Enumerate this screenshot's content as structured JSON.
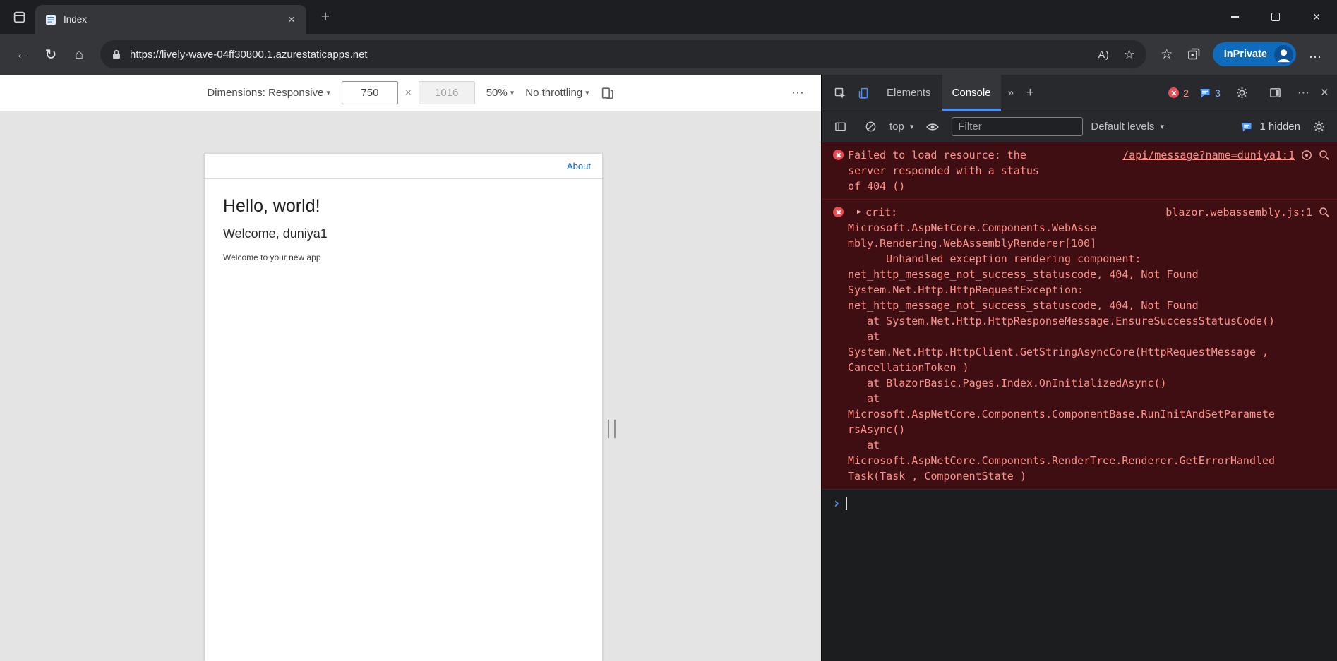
{
  "colors": {
    "accent_blue": "#4e8ef7",
    "inprivate_blue": "#0f6cbd",
    "error_bg": "#3e0e13",
    "error_text": "#ff918a",
    "page_link_blue": "#0366d6"
  },
  "icons": {
    "back": "←",
    "refresh": "↻",
    "home": "⌂",
    "read_aloud": "A)",
    "favorite_star": "☆",
    "favorites_bar": "☆",
    "more_menu": "…",
    "close": "×",
    "tab_close": "×",
    "new_tab": "+",
    "more_tabs": "»",
    "add_panel": "+",
    "dropdown_arrow": "▾",
    "dimension_times": "×",
    "overflow": "⋯",
    "expand_triangle": "▶",
    "prompt_chevron": "›"
  },
  "browser": {
    "tab_title": "Index",
    "url": "https://lively-wave-04ff30800.1.azurestaticapps.net",
    "inprivate_label": "InPrivate"
  },
  "emulation": {
    "dimensions_label": "Dimensions: Responsive",
    "width_value": "750",
    "height_value": "1016",
    "zoom_value": "50%",
    "throttling_value": "No throttling"
  },
  "page": {
    "nav_link_about": "About",
    "heading": "Hello, world!",
    "welcome_text": "Welcome, duniya1",
    "subtitle": "Welcome to your new app"
  },
  "devtools": {
    "tab_elements": "Elements",
    "tab_console": "Console",
    "error_count": "2",
    "issue_count": "3",
    "console_toolbar": {
      "context_selector": "top",
      "filter_placeholder": "Filter",
      "levels_selector": "Default levels",
      "hidden_count": "1 hidden"
    },
    "messages": [
      {
        "text": "Failed to load resource: the\nserver responded with a status\nof 404 ()",
        "source": "/api/message?name=duniya1:1"
      },
      {
        "label": "crit:",
        "source": "blazor.webassembly.js:1",
        "stack": "Microsoft.AspNetCore.Components.WebAsse\nmbly.Rendering.WebAssemblyRenderer[100]\n      Unhandled exception rendering component:\nnet_http_message_not_success_statuscode, 404, Not Found\nSystem.Net.Http.HttpRequestException:\nnet_http_message_not_success_statuscode, 404, Not Found\n   at System.Net.Http.HttpResponseMessage.EnsureSuccessStatusCode()\n   at\nSystem.Net.Http.HttpClient.GetStringAsyncCore(HttpRequestMessage ,\nCancellationToken )\n   at BlazorBasic.Pages.Index.OnInitializedAsync()\n   at\nMicrosoft.AspNetCore.Components.ComponentBase.RunInitAndSetParamete\nrsAsync()\n   at\nMicrosoft.AspNetCore.Components.RenderTree.Renderer.GetErrorHandled\nTask(Task , ComponentState )"
      }
    ]
  }
}
